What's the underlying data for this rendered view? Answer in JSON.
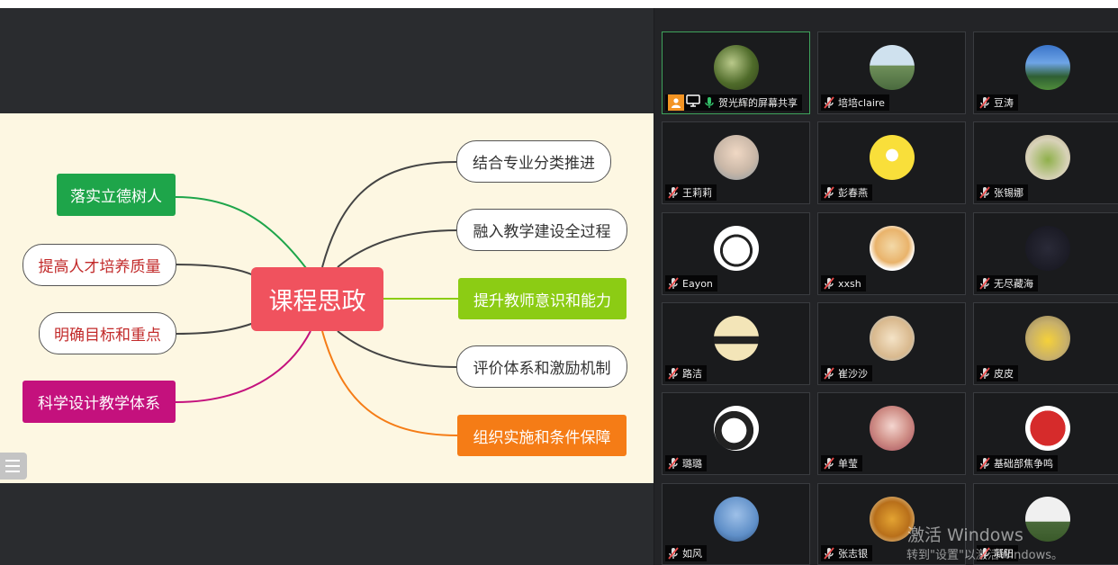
{
  "mindmap": {
    "center": "课程思政",
    "left": [
      {
        "label": "落实立德树人",
        "style": "filled",
        "color": "#1ea54a"
      },
      {
        "label": "提高人才培养质量",
        "style": "outline",
        "text_color": "#c22a2a"
      },
      {
        "label": "明确目标和重点",
        "style": "outline",
        "text_color": "#c22a2a"
      },
      {
        "label": "科学设计教学体系",
        "style": "filled",
        "color": "#c4117d"
      }
    ],
    "right": [
      {
        "label": "结合专业分类推进",
        "style": "outline"
      },
      {
        "label": "融入教学建设全过程",
        "style": "outline"
      },
      {
        "label": "提升教师意识和能力",
        "style": "filled",
        "color": "#8ccc14"
      },
      {
        "label": "评价体系和激励机制",
        "style": "outline"
      },
      {
        "label": "组织实施和条件保障",
        "style": "filled",
        "color": "#f57c16"
      }
    ]
  },
  "participants": [
    {
      "name": "贺光辉的屏幕共享",
      "active": true,
      "avatar": "forest-photo"
    },
    {
      "name": "培培claire",
      "avatar": "landscape-photo"
    },
    {
      "name": "豆涛",
      "avatar": "sky-photo"
    },
    {
      "name": "王莉莉",
      "avatar": "child-photo"
    },
    {
      "name": "彭春燕",
      "avatar": "minion-cartoon"
    },
    {
      "name": "张锡娜",
      "avatar": "plush-toy-photo"
    },
    {
      "name": "Eayon",
      "avatar": "panda-cartoon"
    },
    {
      "name": "xxsh",
      "avatar": "dog-cartoon"
    },
    {
      "name": "无尽藏海",
      "avatar": "calligraphy-dark"
    },
    {
      "name": "路洁",
      "avatar": "group-cartoon"
    },
    {
      "name": "崔沙沙",
      "avatar": "sheep-toy-photo"
    },
    {
      "name": "皮皮",
      "avatar": "pikachu-photo"
    },
    {
      "name": "璐璐",
      "avatar": "girl-cartoon"
    },
    {
      "name": "单莹",
      "avatar": "girl-photo"
    },
    {
      "name": "基础部焦争鸣",
      "avatar": "red-seal"
    },
    {
      "name": "如风",
      "avatar": "tree-sky-photo"
    },
    {
      "name": "张志银",
      "avatar": "autumn-tree-photo"
    },
    {
      "name": "凝阳",
      "avatar": "bench-photo"
    }
  ],
  "watermark": {
    "line1": "激活 Windows",
    "line2": "转到\"设置\"以激活Windows。"
  },
  "colors": {
    "accent_green": "#3fa35c",
    "mic": "#e84a4a"
  }
}
